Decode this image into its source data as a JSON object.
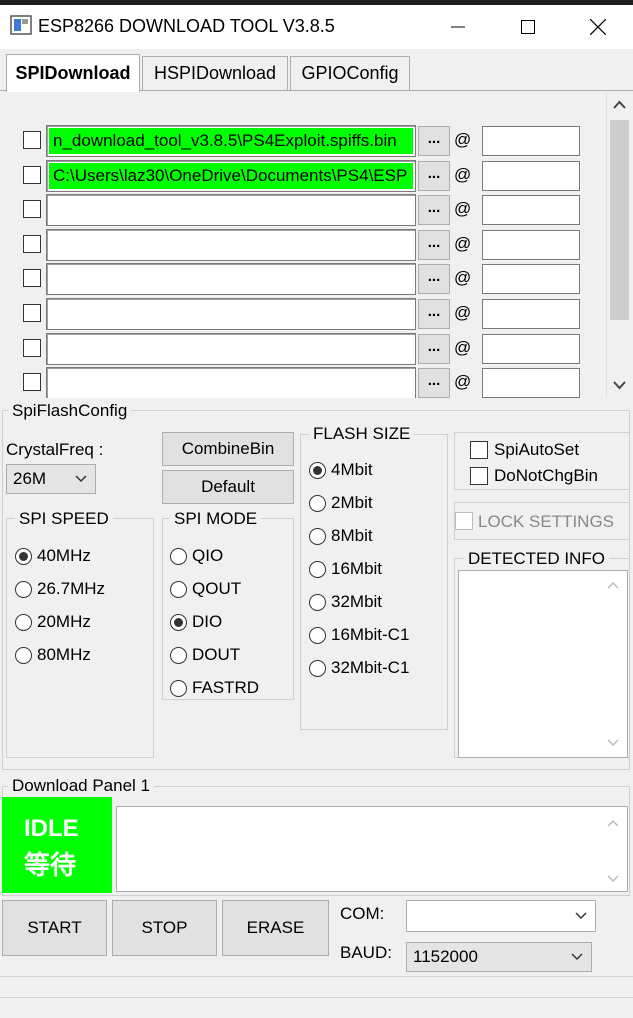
{
  "window": {
    "title": "ESP8266 DOWNLOAD TOOL V3.8.5",
    "minimize_icon": "minimize-icon",
    "maximize_icon": "maximize-icon",
    "close_icon": "close-icon"
  },
  "tabs": [
    {
      "label": "SPIDownload",
      "active": true
    },
    {
      "label": "HSPIDownload",
      "active": false
    },
    {
      "label": "GPIOConfig",
      "active": false
    }
  ],
  "file_rows": [
    {
      "path": "n_download_tool_v3.8.5\\PS4Exploit.spiffs.bin",
      "highlighted": true,
      "checked": false,
      "offset": "",
      "browse_label": "...",
      "at": "@"
    },
    {
      "path": "C:\\Users\\laz30\\OneDrive\\Documents\\PS4\\ESP",
      "highlighted": true,
      "checked": false,
      "offset": "",
      "browse_label": "...",
      "at": "@"
    },
    {
      "path": "",
      "highlighted": false,
      "checked": false,
      "offset": "",
      "browse_label": "...",
      "at": "@"
    },
    {
      "path": "",
      "highlighted": false,
      "checked": false,
      "offset": "",
      "browse_label": "...",
      "at": "@"
    },
    {
      "path": "",
      "highlighted": false,
      "checked": false,
      "offset": "",
      "browse_label": "...",
      "at": "@"
    },
    {
      "path": "",
      "highlighted": false,
      "checked": false,
      "offset": "",
      "browse_label": "...",
      "at": "@"
    },
    {
      "path": "",
      "highlighted": false,
      "checked": false,
      "offset": "",
      "browse_label": "...",
      "at": "@"
    },
    {
      "path": "",
      "highlighted": false,
      "checked": false,
      "offset": "",
      "browse_label": "...",
      "at": "@"
    }
  ],
  "spi_flash_config": {
    "title": "SpiFlashConfig",
    "crystal_freq_label": "CrystalFreq :",
    "crystal_freq_value": "26M",
    "combine_bin_label": "CombineBin",
    "default_label": "Default",
    "spi_speed": {
      "title": "SPI SPEED",
      "options": [
        {
          "label": "40MHz",
          "selected": true
        },
        {
          "label": "26.7MHz",
          "selected": false
        },
        {
          "label": "20MHz",
          "selected": false
        },
        {
          "label": "80MHz",
          "selected": false
        }
      ]
    },
    "spi_mode": {
      "title": "SPI MODE",
      "options": [
        {
          "label": "QIO",
          "selected": false
        },
        {
          "label": "QOUT",
          "selected": false
        },
        {
          "label": "DIO",
          "selected": true
        },
        {
          "label": "DOUT",
          "selected": false
        },
        {
          "label": "FASTRD",
          "selected": false
        }
      ]
    },
    "flash_size": {
      "title": "FLASH SIZE",
      "options": [
        {
          "label": "4Mbit",
          "selected": true
        },
        {
          "label": "2Mbit",
          "selected": false
        },
        {
          "label": "8Mbit",
          "selected": false
        },
        {
          "label": "16Mbit",
          "selected": false
        },
        {
          "label": "32Mbit",
          "selected": false
        },
        {
          "label": "16Mbit-C1",
          "selected": false
        },
        {
          "label": "32Mbit-C1",
          "selected": false
        }
      ]
    },
    "spi_auto_set_label": "SpiAutoSet",
    "do_not_chg_bin_label": "DoNotChgBin",
    "lock_settings_label": "LOCK SETTINGS",
    "detected_info_title": "DETECTED INFO",
    "detected_info_text": ""
  },
  "download_panel": {
    "title": "Download Panel 1",
    "status_en": "IDLE",
    "status_cn": "等待",
    "status_color": "#00ff00",
    "log_text": "",
    "start_label": "START",
    "stop_label": "STOP",
    "erase_label": "ERASE",
    "com_label": "COM:",
    "com_value": "",
    "baud_label": "BAUD:",
    "baud_value": "1152000"
  },
  "colors": {
    "highlight_green": "#00ff00",
    "window_bg": "#f0f0f0"
  }
}
